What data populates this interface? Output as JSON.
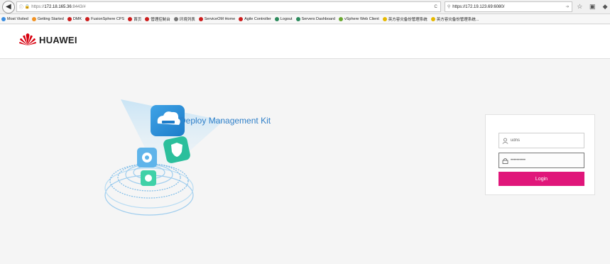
{
  "browser": {
    "back_glyph": "◀",
    "url_prefix": "https://",
    "url_host": "172.18.165.36",
    "url_rest": ":8443/#",
    "reload_glyph": "C",
    "search_text": "https://172.19.123.69:6080/",
    "toolbar_icons": [
      "star-icon",
      "clipboard-icon",
      "shield-icon"
    ]
  },
  "bookmarks": [
    {
      "label": "Most Visited",
      "color": "#3b8de0"
    },
    {
      "label": "Getting Started",
      "color": "#f29222"
    },
    {
      "label": "DMK",
      "color": "#cc1d1d"
    },
    {
      "label": "FusionSphere CPS",
      "color": "#cc1d1d"
    },
    {
      "label": "首页",
      "color": "#cc1d1d"
    },
    {
      "label": "管理控制台",
      "color": "#cc1d1d"
    },
    {
      "label": "环境列表",
      "color": "#777777"
    },
    {
      "label": "ServiceOM Home",
      "color": "#cc1d1d"
    },
    {
      "label": "Agile Controller",
      "color": "#cc1d1d"
    },
    {
      "label": "Logout",
      "color": "#2b8a5c"
    },
    {
      "label": "Servers Dashboard",
      "color": "#2b8a5c"
    },
    {
      "label": "vSphere Web Client",
      "color": "#6aa832"
    },
    {
      "label": "英方容灾备份管理系统",
      "color": "#e6b800"
    },
    {
      "label": "英方容灾备份管理系统...",
      "color": "#e6b800"
    }
  ],
  "header": {
    "brand": "HUAWEI"
  },
  "hero": {
    "title": "Deploy Management Kit"
  },
  "login": {
    "username_value": "udns",
    "password_value": "••••••••••",
    "button_label": "Login"
  },
  "colors": {
    "accent": "#e0167a",
    "title_blue": "#2f7fc8"
  }
}
